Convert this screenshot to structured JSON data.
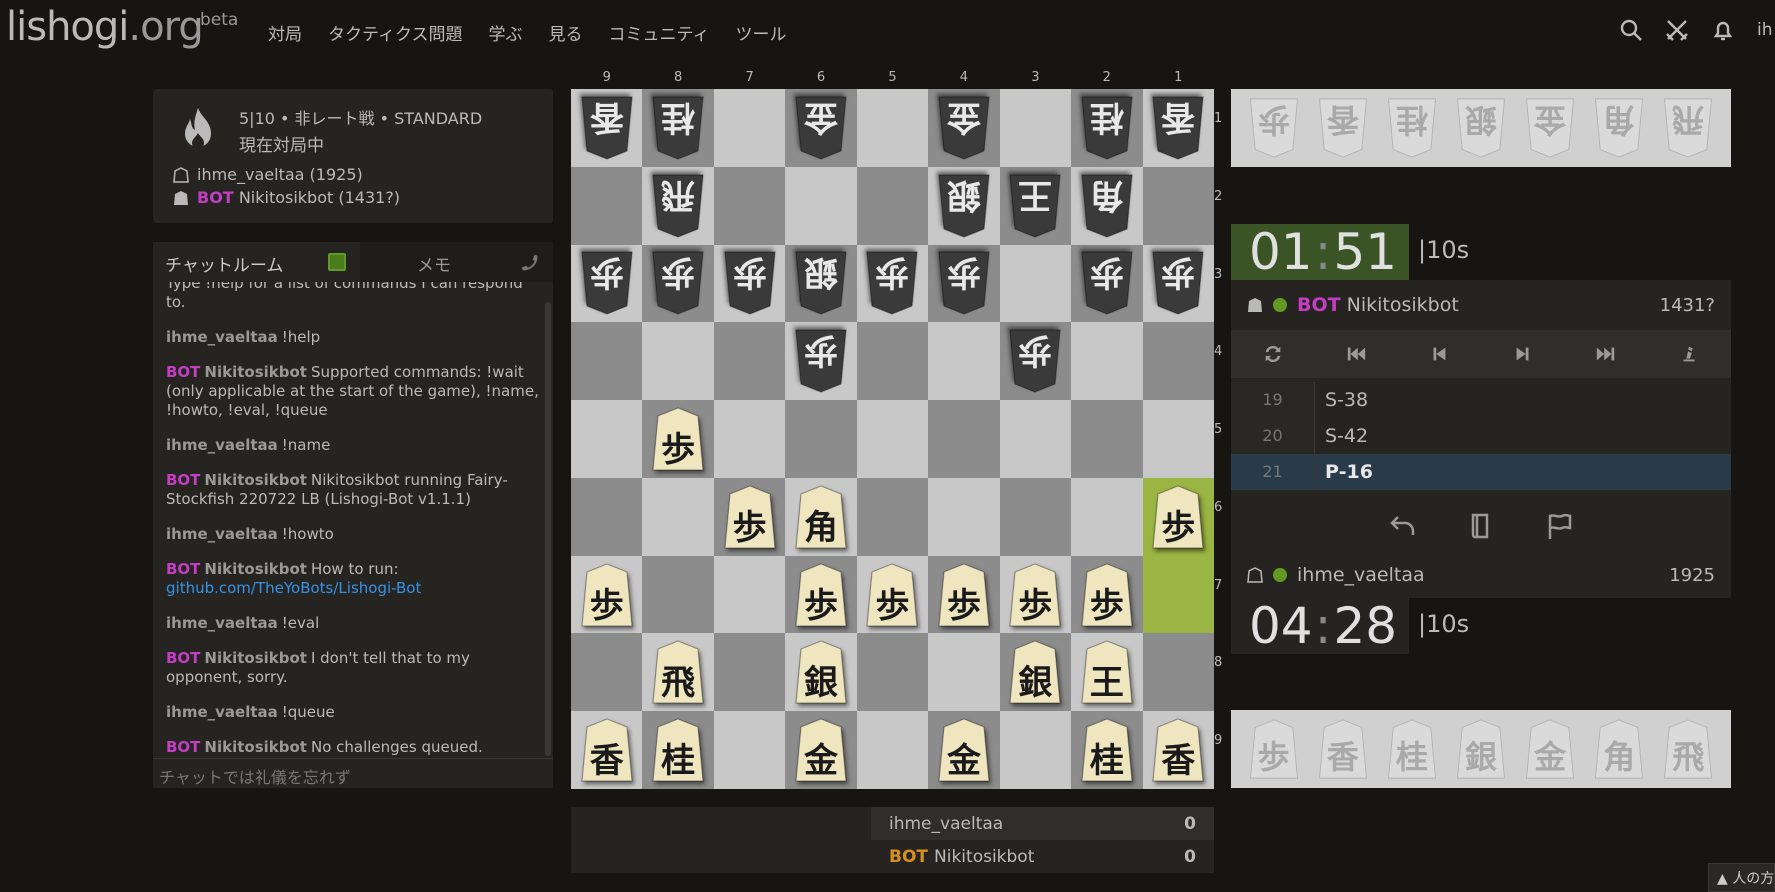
{
  "site": {
    "logo_main": "lishogi",
    "logo_org": ".org",
    "beta": "beta"
  },
  "nav": [
    "対局",
    "タクティクス問題",
    "学ぶ",
    "見る",
    "コミュニティ",
    "ツール"
  ],
  "user_clip": "ih",
  "game": {
    "meta": "5|10 • 非レート戦 • STANDARD",
    "status": "現在対局中",
    "player1": "ihme_vaeltaa (1925)",
    "player2_badge": "BOT",
    "player2": "Nikitosikbot (1431?)"
  },
  "chat": {
    "tab_chat": "チャットルーム",
    "tab_memo": "メモ",
    "placeholder": "チャットでは礼儀を忘れず",
    "partial_line": "Type !help for a list of commands I can respond to.",
    "messages": [
      {
        "bot": false,
        "user": "ihme_vaeltaa",
        "text": "!help"
      },
      {
        "bot": true,
        "badge": "BOT",
        "user": "Nikitosikbot",
        "text": "Supported commands: !wait (only applicable at the start of the game), !name, !howto, !eval, !queue"
      },
      {
        "bot": false,
        "user": "ihme_vaeltaa",
        "text": "!name"
      },
      {
        "bot": true,
        "badge": "BOT",
        "user": "Nikitosikbot",
        "text": "Nikitosikbot running Fairy-Stockfish 220722 LB (Lishogi-Bot v1.1.1)"
      },
      {
        "bot": false,
        "user": "ihme_vaeltaa",
        "text": "!howto"
      },
      {
        "bot": true,
        "badge": "BOT",
        "user": "Nikitosikbot",
        "text": "How to run:",
        "link": "github.com/TheYoBots/Lishogi-Bot"
      },
      {
        "bot": false,
        "user": "ihme_vaeltaa",
        "text": "!eval"
      },
      {
        "bot": true,
        "badge": "BOT",
        "user": "Nikitosikbot",
        "text": "I don't tell that to my opponent, sorry."
      },
      {
        "bot": false,
        "user": "ihme_vaeltaa",
        "text": "!queue"
      },
      {
        "bot": true,
        "badge": "BOT",
        "user": "Nikitosikbot",
        "text": "No challenges queued."
      }
    ]
  },
  "board": {
    "files": [
      "9",
      "8",
      "7",
      "6",
      "5",
      "4",
      "3",
      "2",
      "1"
    ],
    "ranks": [
      "1",
      "2",
      "3",
      "4",
      "5",
      "6",
      "7",
      "8",
      "9"
    ],
    "highlight": [
      "1-6",
      "1-7"
    ],
    "pieces": [
      {
        "sq": "9-1",
        "k": "香",
        "side": "gote"
      },
      {
        "sq": "8-1",
        "k": "桂",
        "side": "gote"
      },
      {
        "sq": "6-1",
        "k": "金",
        "side": "gote"
      },
      {
        "sq": "4-1",
        "k": "金",
        "side": "gote"
      },
      {
        "sq": "2-1",
        "k": "桂",
        "side": "gote"
      },
      {
        "sq": "1-1",
        "k": "香",
        "side": "gote"
      },
      {
        "sq": "8-2",
        "k": "飛",
        "side": "gote"
      },
      {
        "sq": "4-2",
        "k": "銀",
        "side": "gote"
      },
      {
        "sq": "3-2",
        "k": "王",
        "side": "gote"
      },
      {
        "sq": "2-2",
        "k": "角",
        "side": "gote"
      },
      {
        "sq": "9-3",
        "k": "歩",
        "side": "gote"
      },
      {
        "sq": "8-3",
        "k": "歩",
        "side": "gote"
      },
      {
        "sq": "7-3",
        "k": "歩",
        "side": "gote"
      },
      {
        "sq": "6-3",
        "k": "銀",
        "side": "gote"
      },
      {
        "sq": "5-3",
        "k": "歩",
        "side": "gote"
      },
      {
        "sq": "4-3",
        "k": "歩",
        "side": "gote"
      },
      {
        "sq": "2-3",
        "k": "歩",
        "side": "gote"
      },
      {
        "sq": "1-3",
        "k": "歩",
        "side": "gote"
      },
      {
        "sq": "6-4",
        "k": "歩",
        "side": "gote"
      },
      {
        "sq": "3-4",
        "k": "歩",
        "side": "gote"
      },
      {
        "sq": "8-5",
        "k": "歩",
        "side": "sente"
      },
      {
        "sq": "7-6",
        "k": "歩",
        "side": "sente"
      },
      {
        "sq": "6-6",
        "k": "角",
        "side": "sente"
      },
      {
        "sq": "1-6",
        "k": "歩",
        "side": "sente"
      },
      {
        "sq": "9-7",
        "k": "歩",
        "side": "sente"
      },
      {
        "sq": "6-7",
        "k": "歩",
        "side": "sente"
      },
      {
        "sq": "5-7",
        "k": "歩",
        "side": "sente"
      },
      {
        "sq": "4-7",
        "k": "歩",
        "side": "sente"
      },
      {
        "sq": "3-7",
        "k": "歩",
        "side": "sente"
      },
      {
        "sq": "2-7",
        "k": "歩",
        "side": "sente"
      },
      {
        "sq": "8-8",
        "k": "飛",
        "side": "sente"
      },
      {
        "sq": "6-8",
        "k": "銀",
        "side": "sente"
      },
      {
        "sq": "3-8",
        "k": "銀",
        "side": "sente"
      },
      {
        "sq": "2-8",
        "k": "王",
        "side": "sente"
      },
      {
        "sq": "9-9",
        "k": "香",
        "side": "sente"
      },
      {
        "sq": "8-9",
        "k": "桂",
        "side": "sente"
      },
      {
        "sq": "6-9",
        "k": "金",
        "side": "sente"
      },
      {
        "sq": "4-9",
        "k": "金",
        "side": "sente"
      },
      {
        "sq": "2-9",
        "k": "桂",
        "side": "sente"
      },
      {
        "sq": "1-9",
        "k": "香",
        "side": "sente"
      }
    ]
  },
  "hands": {
    "top": [
      "歩",
      "香",
      "桂",
      "銀",
      "金",
      "角",
      "飛"
    ],
    "bottom": [
      "歩",
      "香",
      "桂",
      "銀",
      "金",
      "角",
      "飛"
    ]
  },
  "clocks": {
    "top": {
      "min": "01",
      "sec": "51",
      "incr": "|10s"
    },
    "bottom": {
      "min": "04",
      "sec": "28",
      "incr": "|10s"
    }
  },
  "opponent": {
    "badge": "BOT",
    "name": "Nikitosikbot",
    "rating": "1431?"
  },
  "me": {
    "name": "ihme_vaeltaa",
    "rating": "1925"
  },
  "moves": [
    {
      "no": "19",
      "m": "S-38"
    },
    {
      "no": "20",
      "m": "S-42"
    },
    {
      "no": "21",
      "m": "P-16"
    }
  ],
  "score": {
    "row1_name": "ihme_vaeltaa",
    "row1_val": "0",
    "row2_badge": "BOT",
    "row2_name": "Nikitosikbot",
    "row2_val": "0"
  },
  "corner_text": "人の方"
}
